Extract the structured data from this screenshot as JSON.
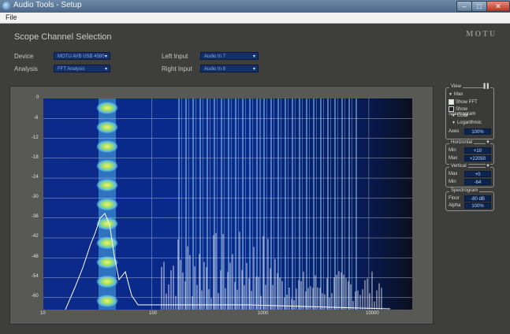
{
  "window": {
    "title": "Audio Tools - Setup",
    "minimize_glyph": "–",
    "maximize_glyph": "□",
    "close_glyph": "✕"
  },
  "menu": {
    "file": "File"
  },
  "header": {
    "heading": "Scope Channel Selection",
    "logo": "MOTU"
  },
  "controls": {
    "device_label": "Device",
    "device_value": "MOTU AVB USB 4580",
    "analysis_label": "Analysis",
    "analysis_value": "FFT Analysis",
    "left_input_label": "Left Input",
    "left_input_value": "Audio In 7",
    "right_input_label": "Right Input",
    "right_input_value": "Audio In 8",
    "dropdown_arrow": "▾"
  },
  "plot": {
    "y_ticks": [
      "0",
      "-6",
      "-12",
      "-18",
      "-24",
      "-30",
      "-36",
      "-42",
      "-48",
      "-54",
      "-60"
    ],
    "x_ticks": [
      "10",
      "100",
      "1000",
      "10000"
    ]
  },
  "panels": {
    "view": {
      "title": "View",
      "pin_glyph": "▌▌",
      "max_label": "Max",
      "show_fft_label": "Show FFT",
      "show_spectrogram_label": "Show Spectrogram",
      "color_label": "Color",
      "logarithmic_label": "Logarithmic",
      "zoom_label": "Axes",
      "zoom_value": "100%"
    },
    "horizontal": {
      "title": "Horizontal",
      "min_label": "Min",
      "min_value": "+10",
      "max_label": "Max",
      "max_value": "+22050"
    },
    "vertical": {
      "title": "Vertical",
      "max_label": "Max",
      "max_value": "+0",
      "min_label": "Min",
      "min_value": "-64"
    },
    "spectrogram": {
      "title": "Spectrogram",
      "floor_label": "Floor",
      "floor_value": "-80 dB",
      "alpha_label": "Alpha",
      "alpha_value": "100%"
    }
  },
  "colors": {
    "plot_background": "#06103a",
    "spectrogram_low": "#0a2a8c",
    "spectrogram_mid": "#6fc3e8",
    "spectrogram_high": "#e9ef6a",
    "fft_trace": "#ffffff"
  }
}
